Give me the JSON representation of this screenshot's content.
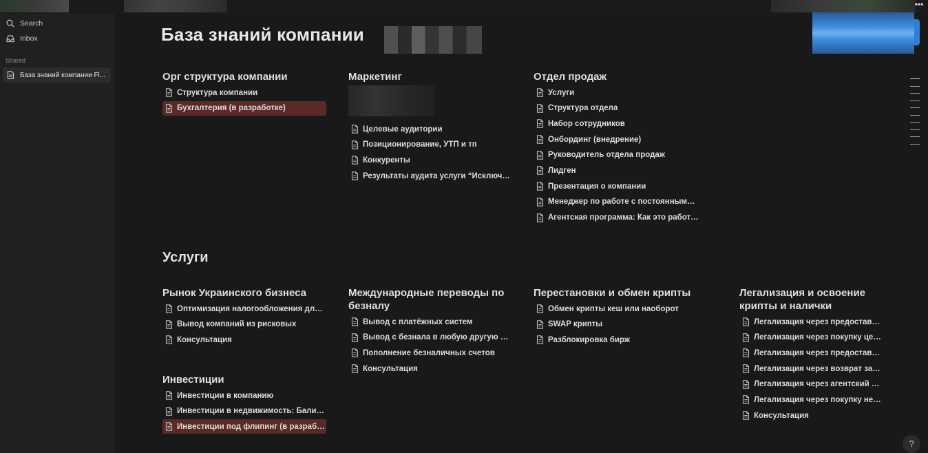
{
  "sidebar": {
    "search_label": "Search",
    "inbox_label": "Inbox",
    "shared_label": "Shared",
    "page_label": "База знаний компании Fl..."
  },
  "page": {
    "title": "База знаний компании",
    "help_label": "?"
  },
  "top_sections": [
    {
      "heading": "Орг структура компании",
      "links": [
        {
          "label": "Структура компании",
          "highlight": false
        },
        {
          "label": "Бухгалтерия (в разработке)",
          "highlight": true
        }
      ]
    },
    {
      "heading": "Маркетинг",
      "links": [
        {
          "label": "Целевые аудитории",
          "highlight": false
        },
        {
          "label": "Позиционирование, УТП и тп",
          "highlight": false
        },
        {
          "label": "Конкуренты",
          "highlight": false
        },
        {
          "label": "Результаты аудита услуги “Исключени...",
          "highlight": false
        }
      ]
    },
    {
      "heading": "Отдел продаж",
      "links": [
        {
          "label": "Услуги",
          "highlight": false
        },
        {
          "label": "Структура отдела",
          "highlight": false
        },
        {
          "label": "Набор сотрудников",
          "highlight": false
        },
        {
          "label": "Онбординг (внедрение)",
          "highlight": false
        },
        {
          "label": "Руководитель отдела продаж",
          "highlight": false
        },
        {
          "label": "Лидген",
          "highlight": false
        },
        {
          "label": "Презентация о компании",
          "highlight": false
        },
        {
          "label": "Менеджер по работе с постоянными ...",
          "highlight": false
        },
        {
          "label": "Агентская программа: Как это работает",
          "highlight": false
        }
      ]
    }
  ],
  "services_title": "Услуги",
  "service_sections": [
    {
      "heading": "Рынок Украинского бизнеса",
      "links": [
        {
          "label": "Оптимизация налогообложения для у...",
          "highlight": false
        },
        {
          "label": "Вывод компаний из рисковых",
          "highlight": false
        },
        {
          "label": "Консультация",
          "highlight": false
        }
      ]
    },
    {
      "heading": "Международные переводы по безналу",
      "links": [
        {
          "label": "Вывод с платёжных систем",
          "highlight": false
        },
        {
          "label": "Вывод с безнала в любую другую вал...",
          "highlight": false
        },
        {
          "label": "Пополнение безналичных счетов",
          "highlight": false
        },
        {
          "label": "Консультация",
          "highlight": false
        }
      ]
    },
    {
      "heading": "Перестановки и обмен крипты",
      "links": [
        {
          "label": "Обмен крипты кеш или наоборот",
          "highlight": false
        },
        {
          "label": "SWAP крипты",
          "highlight": false
        },
        {
          "label": "Разблокировка бирж",
          "highlight": false
        }
      ]
    },
    {
      "heading": "Легализация и освоение крипты и налички",
      "links": [
        {
          "label": "Легализация через предоставле...",
          "highlight": false
        },
        {
          "label": "Легализация через покупку цен...",
          "highlight": false
        },
        {
          "label": "Легализация через предоставле...",
          "highlight": false
        },
        {
          "label": "Легализация через возврат зай...",
          "highlight": false
        },
        {
          "label": "Легализация через агентский до...",
          "highlight": false
        },
        {
          "label": "Легализация через покупку нед...",
          "highlight": false
        },
        {
          "label": "Консультация",
          "highlight": false
        }
      ]
    },
    {
      "heading": "Инвестиции",
      "links": [
        {
          "label": "Инвестиции в компанию",
          "highlight": false
        },
        {
          "label": "Инвестиции в недвижимость: Бали и ...",
          "highlight": false
        },
        {
          "label": "Инвестиции под флипинг (в разработ...",
          "highlight": true
        }
      ]
    }
  ],
  "colors": {
    "background": "#191919",
    "sidebar": "#202020",
    "highlight": "#5b2a27",
    "share_button": "#2f7fd6"
  }
}
